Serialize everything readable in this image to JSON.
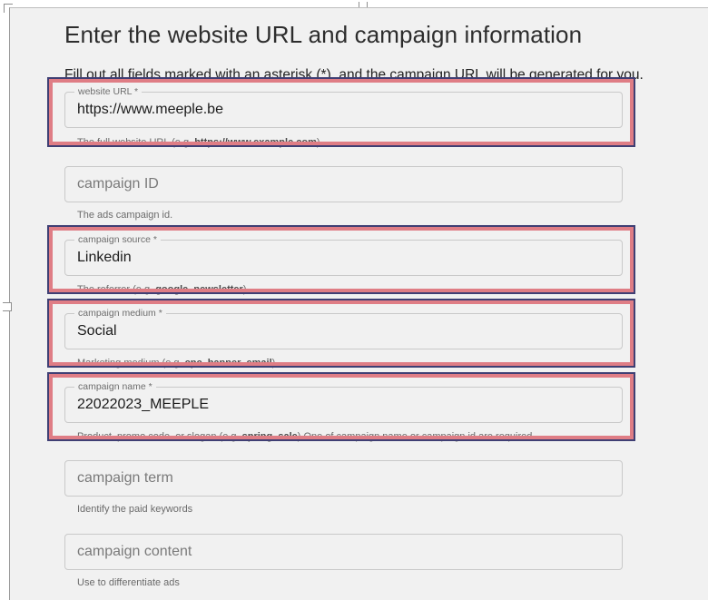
{
  "header": {
    "title": "Enter the website URL and campaign information",
    "intro": "Fill out all fields marked with an asterisk (*), and the campaign URL will be generated for you."
  },
  "fields": {
    "website_url": {
      "label": "website URL *",
      "value": "https://www.meeple.be",
      "hint_pre": "The full website URL (e.g. ",
      "hint_bold": "https://www.example.com",
      "hint_post": ")"
    },
    "campaign_id": {
      "placeholder": "campaign ID",
      "hint": "The ads campaign id."
    },
    "campaign_source": {
      "label": "campaign source *",
      "value": "Linkedin",
      "hint_pre": "The referrer (e.g. ",
      "hint_bold1": "google",
      "hint_sep": ", ",
      "hint_bold2": "newsletter",
      "hint_post": ")"
    },
    "campaign_medium": {
      "label": "campaign medium *",
      "value": "Social",
      "hint_pre": "Marketing medium (e.g. ",
      "hint_bold1": "cpc",
      "hint_sep1": ", ",
      "hint_bold2": "banner",
      "hint_sep2": ", ",
      "hint_bold3": "email",
      "hint_post": ")"
    },
    "campaign_name": {
      "label": "campaign name *",
      "value": "22022023_MEEPLE",
      "hint_pre": "Product, promo code, or slogan (e.g. ",
      "hint_bold": "spring_sale",
      "hint_post": ") One of campaign name or campaign id are required."
    },
    "campaign_term": {
      "placeholder": "campaign term",
      "hint": "Identify the paid keywords"
    },
    "campaign_content": {
      "placeholder": "campaign content",
      "hint": "Use to differentiate ads"
    }
  },
  "colors": {
    "highlight_fill": "#df7d85",
    "highlight_border": "#3f3f74",
    "panel_background": "#f1f1f1"
  }
}
